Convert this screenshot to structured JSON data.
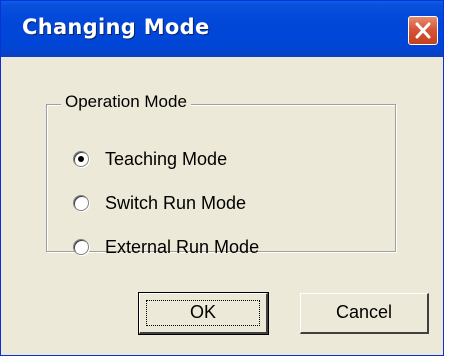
{
  "dialog": {
    "title": "Changing Mode",
    "close_icon": "close-icon"
  },
  "group": {
    "label": "Operation Mode",
    "options": [
      {
        "label": "Teaching Mode",
        "selected": true
      },
      {
        "label": "Switch Run Mode",
        "selected": false
      },
      {
        "label": "External Run Mode",
        "selected": false
      }
    ]
  },
  "buttons": {
    "ok_label": "OK",
    "cancel_label": "Cancel"
  },
  "colors": {
    "titlebar": "#0047d9",
    "dialog_bg": "#ece9d8",
    "close_button": "#d8553a"
  }
}
